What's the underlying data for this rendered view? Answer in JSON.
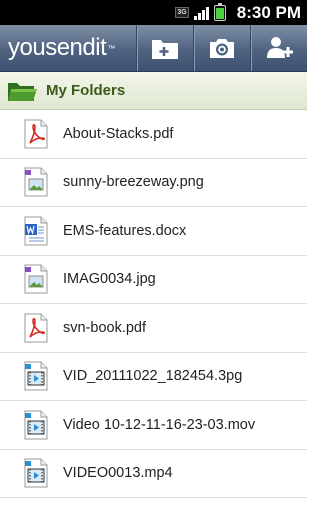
{
  "status_bar": {
    "network_label": "3G",
    "time": "8:30 PM"
  },
  "header": {
    "logo_text": "yousendit",
    "logo_mark": "™",
    "buttons": [
      {
        "icon": "new-folder-icon"
      },
      {
        "icon": "camera-icon"
      },
      {
        "icon": "add-user-icon"
      }
    ]
  },
  "folders_bar": {
    "title": "My Folders",
    "icon": "folder-icon"
  },
  "files": [
    {
      "name": "About-Stacks.pdf",
      "type": "pdf"
    },
    {
      "name": "sunny-breezeway.png",
      "type": "image"
    },
    {
      "name": "EMS-features.docx",
      "type": "doc"
    },
    {
      "name": "IMAG0034.jpg",
      "type": "image"
    },
    {
      "name": "svn-book.pdf",
      "type": "pdf"
    },
    {
      "name": "VID_20111022_182454.3pg",
      "type": "video"
    },
    {
      "name": "Video 10-12-11-16-23-03.mov",
      "type": "video"
    },
    {
      "name": "VIDEO0013.mp4",
      "type": "video"
    }
  ],
  "colors": {
    "header_blue": "#4f6280",
    "folder_bar_green": "#dfe7cf",
    "folders_text": "#3a5a1a",
    "pdf_red": "#d42a20",
    "image_purple": "#8a4fc4",
    "doc_blue": "#2a63c4",
    "video_blue": "#2a8fd4"
  }
}
